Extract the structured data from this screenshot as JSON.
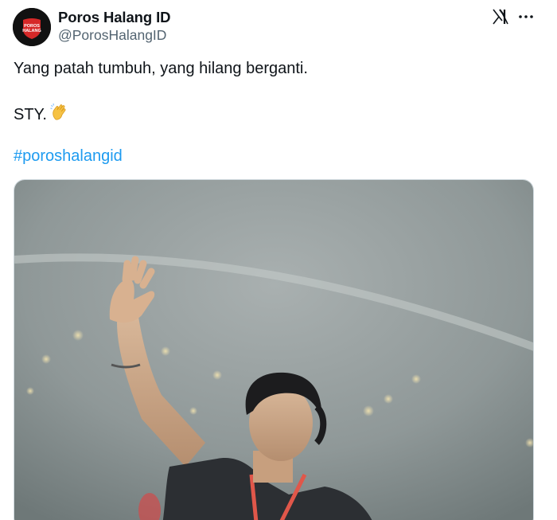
{
  "author": {
    "display_name": "Poros Halang ID",
    "handle": "@PorosHalangID",
    "avatar_text_top": "POROS",
    "avatar_text_bottom": "HALANG"
  },
  "tweet": {
    "line1": "Yang patah tumbuh, yang hilang berganti.",
    "line2": "STY.",
    "line2_emoji": "clapping-hands-icon",
    "hashtag": "#poroshalangid"
  },
  "media": {
    "description_icon": "photo"
  },
  "colors": {
    "text": "#0f1419",
    "secondary": "#536471",
    "link": "#1d9bf0",
    "avatar_bg": "#111111",
    "avatar_badge": "#d62828"
  }
}
